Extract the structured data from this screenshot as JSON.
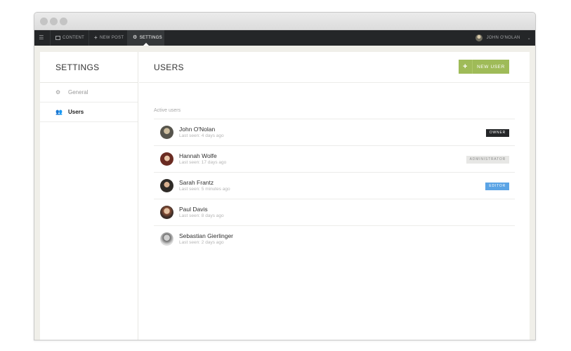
{
  "navbar": {
    "content_label": "CONTENT",
    "new_post_label": "NEW POST",
    "settings_label": "SETTINGS",
    "user_name": "JOHN O'NOLAN"
  },
  "sidebar": {
    "title": "SETTINGS",
    "items": [
      {
        "label": "General",
        "icon": "gear-icon"
      },
      {
        "label": "Users",
        "icon": "users-icon"
      }
    ]
  },
  "main": {
    "title": "USERS",
    "new_user_label": "NEW USER",
    "section_label": "Active users",
    "users": [
      {
        "name": "John O'Nolan",
        "last_seen": "Last seen: 4 days ago",
        "role": "OWNER"
      },
      {
        "name": "Hannah Wolfe",
        "last_seen": "Last seen: 17 days ago",
        "role": "ADMINISTRATOR"
      },
      {
        "name": "Sarah Frantz",
        "last_seen": "Last seen: 5 minutes ago",
        "role": "EDITOR"
      },
      {
        "name": "Paul Davis",
        "last_seen": "Last seen: 8 days ago",
        "role": ""
      },
      {
        "name": "Sebastian Gierlinger",
        "last_seen": "Last seen: 2 days ago",
        "role": ""
      }
    ]
  },
  "colors": {
    "navbar_bg": "#242628",
    "accent_green": "#9fbb58",
    "editor_blue": "#5ba4e5",
    "owner_badge": "#242628"
  }
}
